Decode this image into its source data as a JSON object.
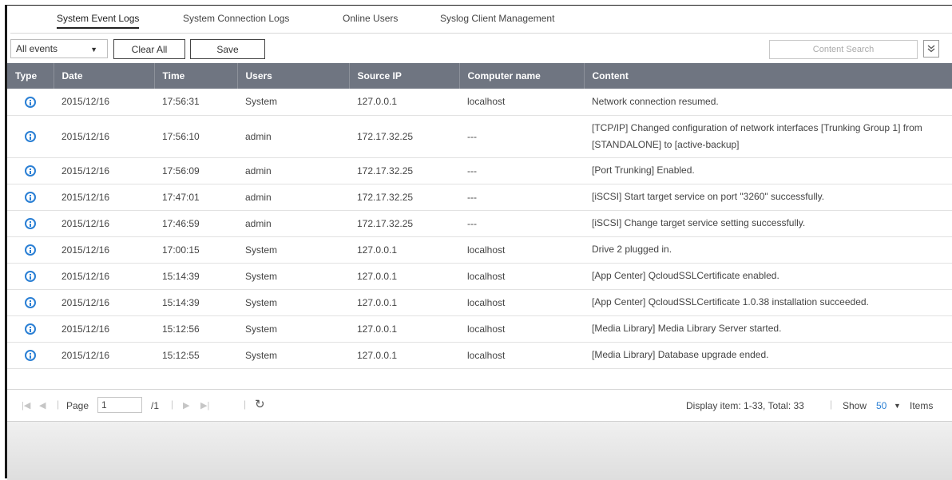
{
  "tabs": [
    {
      "label": "System Event Logs"
    },
    {
      "label": "System Connection Logs"
    },
    {
      "label": "Online Users"
    },
    {
      "label": "Syslog Client Management"
    }
  ],
  "toolbar": {
    "filter_value": "All events",
    "clear_label": "Clear All",
    "save_label": "Save",
    "search_placeholder": "Content Search"
  },
  "table": {
    "headers": [
      "Type",
      "Date",
      "Time",
      "Users",
      "Source IP",
      "Computer name",
      "Content"
    ],
    "rows": [
      {
        "date": "2015/12/16",
        "time": "17:56:31",
        "user": "System",
        "ip": "127.0.0.1",
        "computer": "localhost",
        "content": "Network connection resumed."
      },
      {
        "date": "2015/12/16",
        "time": "17:56:10",
        "user": "admin",
        "ip": "172.17.32.25",
        "computer": "---",
        "content": "[TCP/IP] Changed configuration of network interfaces [Trunking Group 1] from [STANDALONE] to [active-backup]"
      },
      {
        "date": "2015/12/16",
        "time": "17:56:09",
        "user": "admin",
        "ip": "172.17.32.25",
        "computer": "---",
        "content": "[Port Trunking] Enabled."
      },
      {
        "date": "2015/12/16",
        "time": "17:47:01",
        "user": "admin",
        "ip": "172.17.32.25",
        "computer": "---",
        "content": "[iSCSI] Start target service on port \"3260\" successfully."
      },
      {
        "date": "2015/12/16",
        "time": "17:46:59",
        "user": "admin",
        "ip": "172.17.32.25",
        "computer": "---",
        "content": "[iSCSI] Change target service setting successfully."
      },
      {
        "date": "2015/12/16",
        "time": "17:00:15",
        "user": "System",
        "ip": "127.0.0.1",
        "computer": "localhost",
        "content": "Drive 2 plugged in."
      },
      {
        "date": "2015/12/16",
        "time": "15:14:39",
        "user": "System",
        "ip": "127.0.0.1",
        "computer": "localhost",
        "content": "[App Center] QcloudSSLCertificate enabled."
      },
      {
        "date": "2015/12/16",
        "time": "15:14:39",
        "user": "System",
        "ip": "127.0.0.1",
        "computer": "localhost",
        "content": "[App Center] QcloudSSLCertificate 1.0.38 installation succeeded."
      },
      {
        "date": "2015/12/16",
        "time": "15:12:56",
        "user": "System",
        "ip": "127.0.0.1",
        "computer": "localhost",
        "content": "[Media Library] Media Library Server started."
      },
      {
        "date": "2015/12/16",
        "time": "15:12:55",
        "user": "System",
        "ip": "127.0.0.1",
        "computer": "localhost",
        "content": "[Media Library] Database upgrade ended."
      }
    ]
  },
  "pager": {
    "page_label": "Page",
    "page_value": "1",
    "total_pages": "/1",
    "display_info": "Display item: 1-33, Total: 33",
    "show_label": "Show",
    "show_value": "50",
    "items_label": "Items"
  },
  "colors": {
    "header_bg": "#6f7581",
    "accent": "#2a7fd4"
  },
  "icons": {
    "type": "info-icon",
    "refresh": "refresh-icon",
    "search_toggle": "double-chevron-down-icon"
  }
}
